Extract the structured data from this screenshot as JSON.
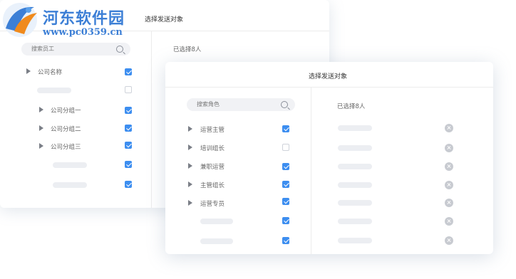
{
  "watermark": {
    "name": "河东软件园",
    "url": "www.pc0359.cn"
  },
  "back_panel": {
    "title": "选择发送对象",
    "search_placeholder": "搜索员工",
    "selected_count": "已选择8人",
    "tree": [
      {
        "label": "公司名称",
        "expandable": true,
        "checked": true
      },
      {
        "label": "",
        "expandable": false,
        "checked": false
      },
      {
        "label": "公司分组一",
        "expandable": true,
        "checked": true
      },
      {
        "label": "公司分组二",
        "expandable": true,
        "checked": true
      },
      {
        "label": "公司分组三",
        "expandable": true,
        "checked": true
      },
      {
        "label": "",
        "expandable": false,
        "checked": true
      },
      {
        "label": "",
        "expandable": false,
        "checked": true
      }
    ]
  },
  "front_panel": {
    "title": "选择发送对象",
    "search_placeholder": "搜索角色",
    "selected_count": "已选择8人",
    "roles": [
      {
        "label": "运营主管",
        "expandable": true,
        "checked": true
      },
      {
        "label": "培训组长",
        "expandable": true,
        "checked": false
      },
      {
        "label": "兼职运营",
        "expandable": true,
        "checked": true
      },
      {
        "label": "主管组长",
        "expandable": true,
        "checked": true
      },
      {
        "label": "运营专员",
        "expandable": true,
        "checked": true
      },
      {
        "label": "",
        "expandable": false,
        "checked": true
      },
      {
        "label": "",
        "expandable": false,
        "checked": true
      }
    ],
    "selected_items": 7
  },
  "colors": {
    "accent": "#3d8ef0",
    "logo": "#3c7fd6"
  }
}
